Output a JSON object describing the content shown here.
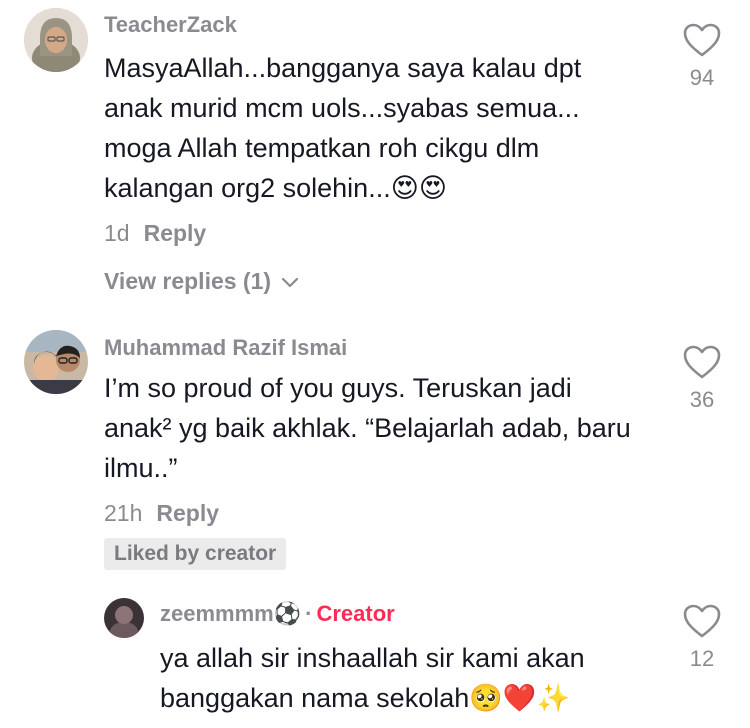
{
  "comments": [
    {
      "username": "TeacherZack",
      "text": "MasyaAllah...bangganya saya kalau dpt anak murid mcm uols...syabas semua... moga Allah tempatkan roh cikgu dlm kalangan org2 solehin...",
      "emoji": "😍😍",
      "time": "1d",
      "reply_label": "Reply",
      "likes": "94",
      "view_replies": "View replies (1)"
    },
    {
      "username": "Muhammad Razif Ismai",
      "text": "I’m so proud of you guys. Teruskan jadi anak² yg baik akhlak. “Belajarlah adab, baru ilmu..”",
      "time": "21h",
      "reply_label": "Reply",
      "likes": "36",
      "liked_by": "Liked by creator"
    }
  ],
  "reply": {
    "username": "zeemmmm",
    "username_emoji": "⚽",
    "dot": "·",
    "badge": "Creator",
    "text": "ya allah sir inshaallah sir kami akan banggakan nama sekolah",
    "emoji": "🥺❤️✨",
    "likes": "12"
  },
  "icons": {
    "like": "heart-outline-icon",
    "chevron": "chevron-down-icon"
  }
}
